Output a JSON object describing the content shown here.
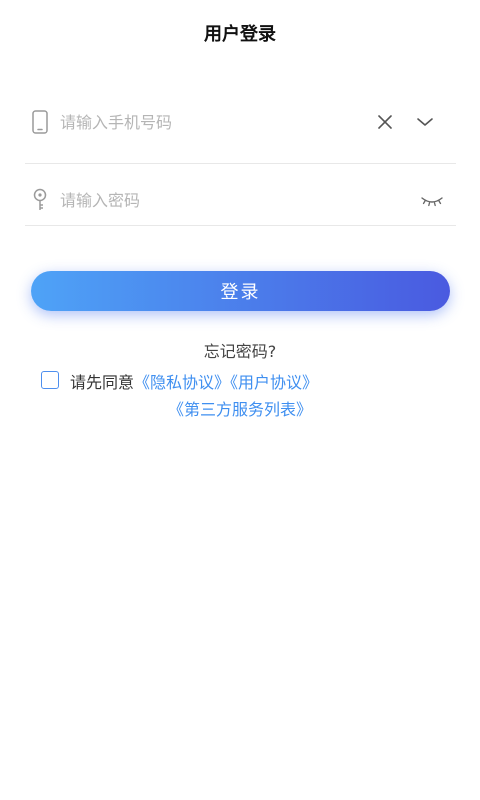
{
  "header": {
    "title": "用户登录"
  },
  "phone_field": {
    "placeholder": "请输入手机号码",
    "value": ""
  },
  "password_field": {
    "placeholder": "请输入密码",
    "value": ""
  },
  "login": {
    "button_label": "登录"
  },
  "forgot": {
    "label": "忘记密码?"
  },
  "agreement": {
    "prefix": "请先同意",
    "privacy": "《隐私协议》",
    "user": "《用户协议》",
    "third_party": "《第三方服务列表》"
  },
  "colors": {
    "accent": "#3f8ff0",
    "button_start": "#4ea3f7",
    "button_end": "#4a5ae0",
    "placeholder": "#b5b5b5",
    "divider": "#e8e8e8"
  },
  "icons": {
    "phone": "phone-icon",
    "key": "key-icon",
    "clear": "close-icon",
    "dropdown": "chevron-down-icon",
    "eye": "eye-closed-icon"
  }
}
